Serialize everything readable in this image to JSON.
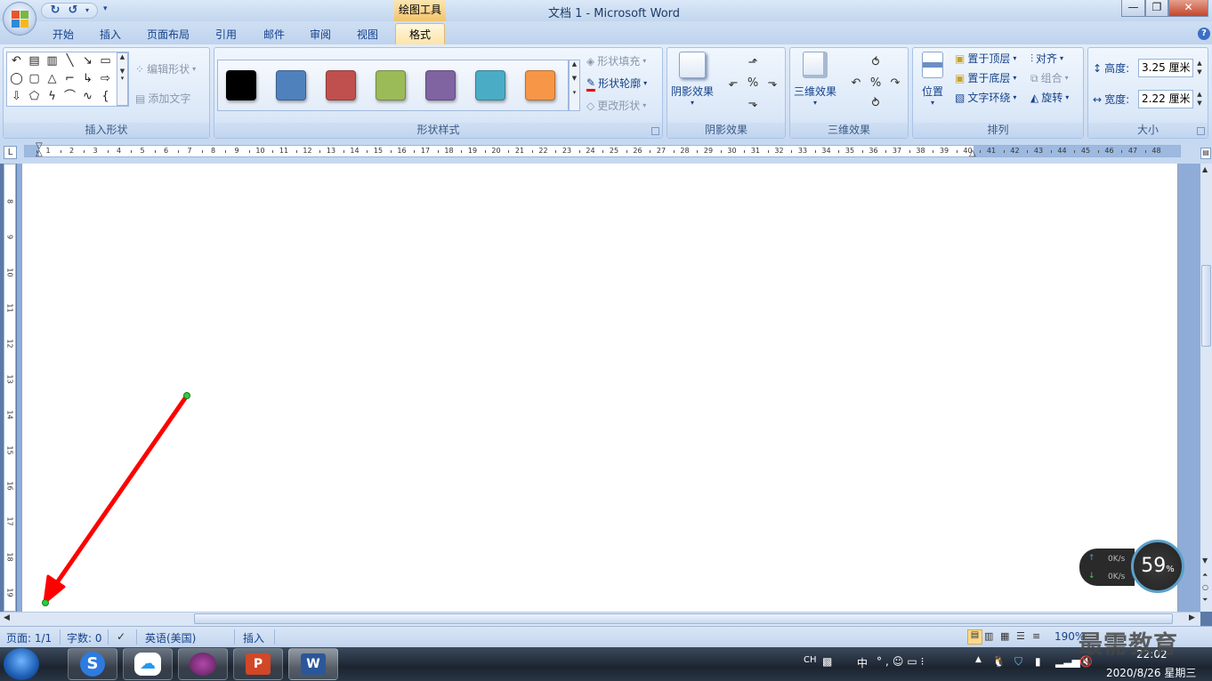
{
  "titlebar": {
    "contextual_tab": "绘图工具",
    "doc_title": "文档 1 - Microsoft Word",
    "minimize": "—",
    "restore": "❐",
    "close": "✕"
  },
  "tabs": [
    "开始",
    "插入",
    "页面布局",
    "引用",
    "邮件",
    "审阅",
    "视图",
    "格式"
  ],
  "active_tab": "格式",
  "ribbon": {
    "insert_shapes": {
      "label": "插入形状",
      "edit_shape": "编辑形状",
      "add_text": "添加文字"
    },
    "shape_styles": {
      "label": "形状样式",
      "swatches": [
        "#000000",
        "#4f81bd",
        "#c0504d",
        "#9bbb59",
        "#8064a2",
        "#4bacc6",
        "#f79646"
      ],
      "fill": "形状填充",
      "outline": "形状轮廓",
      "change": "更改形状"
    },
    "shadow": {
      "label": "阴影效果",
      "button": "阴影效果"
    },
    "threed": {
      "label": "三维效果",
      "button": "三维效果"
    },
    "arrange": {
      "label": "排列",
      "position": "位置",
      "bring_front": "置于顶层",
      "send_back": "置于底层",
      "text_wrap": "文字环绕",
      "align": "对齐",
      "group": "组合",
      "rotate": "旋转"
    },
    "size": {
      "label": "大小",
      "height_label": "高度:",
      "height_value": "3.25 厘米",
      "width_label": "宽度:",
      "width_value": "2.22 厘米"
    }
  },
  "ruler": {
    "h_numbers": [
      "1",
      "2",
      "3",
      "4",
      "5",
      "6",
      "7",
      "8",
      "9",
      "10",
      "11",
      "12",
      "13",
      "14",
      "15",
      "16",
      "17",
      "18",
      "19",
      "20",
      "21",
      "22",
      "23",
      "24",
      "25",
      "26",
      "27",
      "28",
      "29",
      "30",
      "31",
      "32",
      "33",
      "34",
      "35",
      "36",
      "37",
      "38",
      "39",
      "40",
      "41",
      "42",
      "43",
      "44",
      "45",
      "46",
      "47",
      "48"
    ],
    "v_numbers": [
      "8",
      "9",
      "10",
      "11",
      "12",
      "13",
      "14",
      "15",
      "16",
      "17",
      "18",
      "19"
    ]
  },
  "statusbar": {
    "page": "页面: 1/1",
    "words": "字数: 0",
    "language": "英语(美国)",
    "mode": "插入",
    "zoom": "190%"
  },
  "network": {
    "up": "0K/s",
    "down": "0K/s",
    "percent": "59",
    "percent_unit": "%"
  },
  "taskbar": {
    "tray_lang": "CH",
    "ime": "中",
    "time": "22:02",
    "date": "2020/8/26 星期三"
  },
  "watermark": "最需教育",
  "colors": {
    "arrow": "#ff0000",
    "handle": "#2ecc40"
  }
}
